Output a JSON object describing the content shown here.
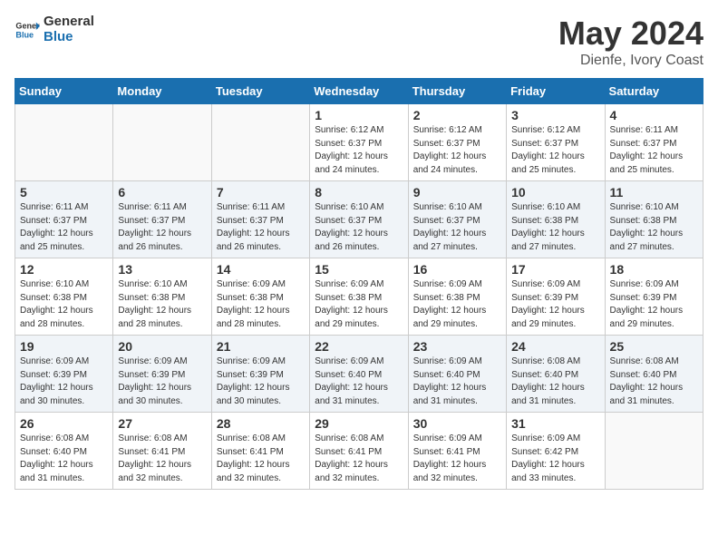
{
  "logo": {
    "text_general": "General",
    "text_blue": "Blue"
  },
  "header": {
    "title": "May 2024",
    "subtitle": "Dienfe, Ivory Coast"
  },
  "weekdays": [
    "Sunday",
    "Monday",
    "Tuesday",
    "Wednesday",
    "Thursday",
    "Friday",
    "Saturday"
  ],
  "weeks": [
    [
      {
        "day": "",
        "info": ""
      },
      {
        "day": "",
        "info": ""
      },
      {
        "day": "",
        "info": ""
      },
      {
        "day": "1",
        "info": "Sunrise: 6:12 AM\nSunset: 6:37 PM\nDaylight: 12 hours\nand 24 minutes."
      },
      {
        "day": "2",
        "info": "Sunrise: 6:12 AM\nSunset: 6:37 PM\nDaylight: 12 hours\nand 24 minutes."
      },
      {
        "day": "3",
        "info": "Sunrise: 6:12 AM\nSunset: 6:37 PM\nDaylight: 12 hours\nand 25 minutes."
      },
      {
        "day": "4",
        "info": "Sunrise: 6:11 AM\nSunset: 6:37 PM\nDaylight: 12 hours\nand 25 minutes."
      }
    ],
    [
      {
        "day": "5",
        "info": "Sunrise: 6:11 AM\nSunset: 6:37 PM\nDaylight: 12 hours\nand 25 minutes."
      },
      {
        "day": "6",
        "info": "Sunrise: 6:11 AM\nSunset: 6:37 PM\nDaylight: 12 hours\nand 26 minutes."
      },
      {
        "day": "7",
        "info": "Sunrise: 6:11 AM\nSunset: 6:37 PM\nDaylight: 12 hours\nand 26 minutes."
      },
      {
        "day": "8",
        "info": "Sunrise: 6:10 AM\nSunset: 6:37 PM\nDaylight: 12 hours\nand 26 minutes."
      },
      {
        "day": "9",
        "info": "Sunrise: 6:10 AM\nSunset: 6:37 PM\nDaylight: 12 hours\nand 27 minutes."
      },
      {
        "day": "10",
        "info": "Sunrise: 6:10 AM\nSunset: 6:38 PM\nDaylight: 12 hours\nand 27 minutes."
      },
      {
        "day": "11",
        "info": "Sunrise: 6:10 AM\nSunset: 6:38 PM\nDaylight: 12 hours\nand 27 minutes."
      }
    ],
    [
      {
        "day": "12",
        "info": "Sunrise: 6:10 AM\nSunset: 6:38 PM\nDaylight: 12 hours\nand 28 minutes."
      },
      {
        "day": "13",
        "info": "Sunrise: 6:10 AM\nSunset: 6:38 PM\nDaylight: 12 hours\nand 28 minutes."
      },
      {
        "day": "14",
        "info": "Sunrise: 6:09 AM\nSunset: 6:38 PM\nDaylight: 12 hours\nand 28 minutes."
      },
      {
        "day": "15",
        "info": "Sunrise: 6:09 AM\nSunset: 6:38 PM\nDaylight: 12 hours\nand 29 minutes."
      },
      {
        "day": "16",
        "info": "Sunrise: 6:09 AM\nSunset: 6:38 PM\nDaylight: 12 hours\nand 29 minutes."
      },
      {
        "day": "17",
        "info": "Sunrise: 6:09 AM\nSunset: 6:39 PM\nDaylight: 12 hours\nand 29 minutes."
      },
      {
        "day": "18",
        "info": "Sunrise: 6:09 AM\nSunset: 6:39 PM\nDaylight: 12 hours\nand 29 minutes."
      }
    ],
    [
      {
        "day": "19",
        "info": "Sunrise: 6:09 AM\nSunset: 6:39 PM\nDaylight: 12 hours\nand 30 minutes."
      },
      {
        "day": "20",
        "info": "Sunrise: 6:09 AM\nSunset: 6:39 PM\nDaylight: 12 hours\nand 30 minutes."
      },
      {
        "day": "21",
        "info": "Sunrise: 6:09 AM\nSunset: 6:39 PM\nDaylight: 12 hours\nand 30 minutes."
      },
      {
        "day": "22",
        "info": "Sunrise: 6:09 AM\nSunset: 6:40 PM\nDaylight: 12 hours\nand 31 minutes."
      },
      {
        "day": "23",
        "info": "Sunrise: 6:09 AM\nSunset: 6:40 PM\nDaylight: 12 hours\nand 31 minutes."
      },
      {
        "day": "24",
        "info": "Sunrise: 6:08 AM\nSunset: 6:40 PM\nDaylight: 12 hours\nand 31 minutes."
      },
      {
        "day": "25",
        "info": "Sunrise: 6:08 AM\nSunset: 6:40 PM\nDaylight: 12 hours\nand 31 minutes."
      }
    ],
    [
      {
        "day": "26",
        "info": "Sunrise: 6:08 AM\nSunset: 6:40 PM\nDaylight: 12 hours\nand 31 minutes."
      },
      {
        "day": "27",
        "info": "Sunrise: 6:08 AM\nSunset: 6:41 PM\nDaylight: 12 hours\nand 32 minutes."
      },
      {
        "day": "28",
        "info": "Sunrise: 6:08 AM\nSunset: 6:41 PM\nDaylight: 12 hours\nand 32 minutes."
      },
      {
        "day": "29",
        "info": "Sunrise: 6:08 AM\nSunset: 6:41 PM\nDaylight: 12 hours\nand 32 minutes."
      },
      {
        "day": "30",
        "info": "Sunrise: 6:09 AM\nSunset: 6:41 PM\nDaylight: 12 hours\nand 32 minutes."
      },
      {
        "day": "31",
        "info": "Sunrise: 6:09 AM\nSunset: 6:42 PM\nDaylight: 12 hours\nand 33 minutes."
      },
      {
        "day": "",
        "info": ""
      }
    ]
  ]
}
